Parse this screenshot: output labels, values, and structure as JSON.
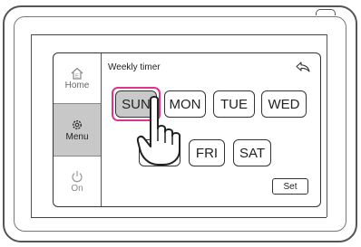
{
  "screen": {
    "title": "Weekly timer"
  },
  "sidebar": {
    "items": [
      {
        "label": "Home",
        "icon": "home-icon",
        "selected": false
      },
      {
        "label": "Menu",
        "icon": "gear-icon",
        "selected": true
      },
      {
        "label": "On",
        "icon": "power-icon",
        "selected": false
      }
    ]
  },
  "days": {
    "row1": [
      "SUN",
      "MON",
      "TUE",
      "WED"
    ],
    "row2_visible": [
      "FRI",
      "SAT"
    ],
    "selected": "SUN"
  },
  "buttons": {
    "set_label": "Set"
  },
  "colors": {
    "selection_ring": "#e0338e",
    "selected_fill": "#c9c9c9",
    "menu_highlight": "#c8c8c8"
  }
}
